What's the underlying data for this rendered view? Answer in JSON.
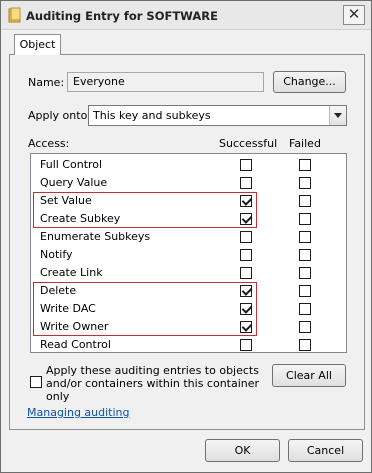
{
  "window": {
    "title": "Auditing Entry for SOFTWARE",
    "close_symbol": "✕"
  },
  "tab": {
    "label": "Object"
  },
  "name": {
    "label": "Name:",
    "value": "Everyone",
    "change_button": "Change..."
  },
  "apply_onto": {
    "label": "Apply onto:",
    "selected": "This key and subkeys"
  },
  "access": {
    "label": "Access:",
    "col_successful": "Successful",
    "col_failed": "Failed",
    "rows": [
      {
        "label": "Full Control",
        "successful": false,
        "failed": false
      },
      {
        "label": "Query Value",
        "successful": false,
        "failed": false
      },
      {
        "label": "Set Value",
        "successful": true,
        "failed": false
      },
      {
        "label": "Create Subkey",
        "successful": true,
        "failed": false
      },
      {
        "label": "Enumerate Subkeys",
        "successful": false,
        "failed": false
      },
      {
        "label": "Notify",
        "successful": false,
        "failed": false
      },
      {
        "label": "Create Link",
        "successful": false,
        "failed": false
      },
      {
        "label": "Delete",
        "successful": true,
        "failed": false
      },
      {
        "label": "Write DAC",
        "successful": true,
        "failed": false
      },
      {
        "label": "Write Owner",
        "successful": true,
        "failed": false
      },
      {
        "label": "Read Control",
        "successful": false,
        "failed": false
      }
    ],
    "highlight_color": "#c0303a"
  },
  "apply_children": {
    "checked": false,
    "line1": "Apply these auditing entries to objects",
    "line2": "and/or containers within this container",
    "line3": "only"
  },
  "clear_all_button": "Clear All",
  "help_link": "Managing auditing",
  "footer": {
    "ok": "OK",
    "cancel": "Cancel"
  }
}
